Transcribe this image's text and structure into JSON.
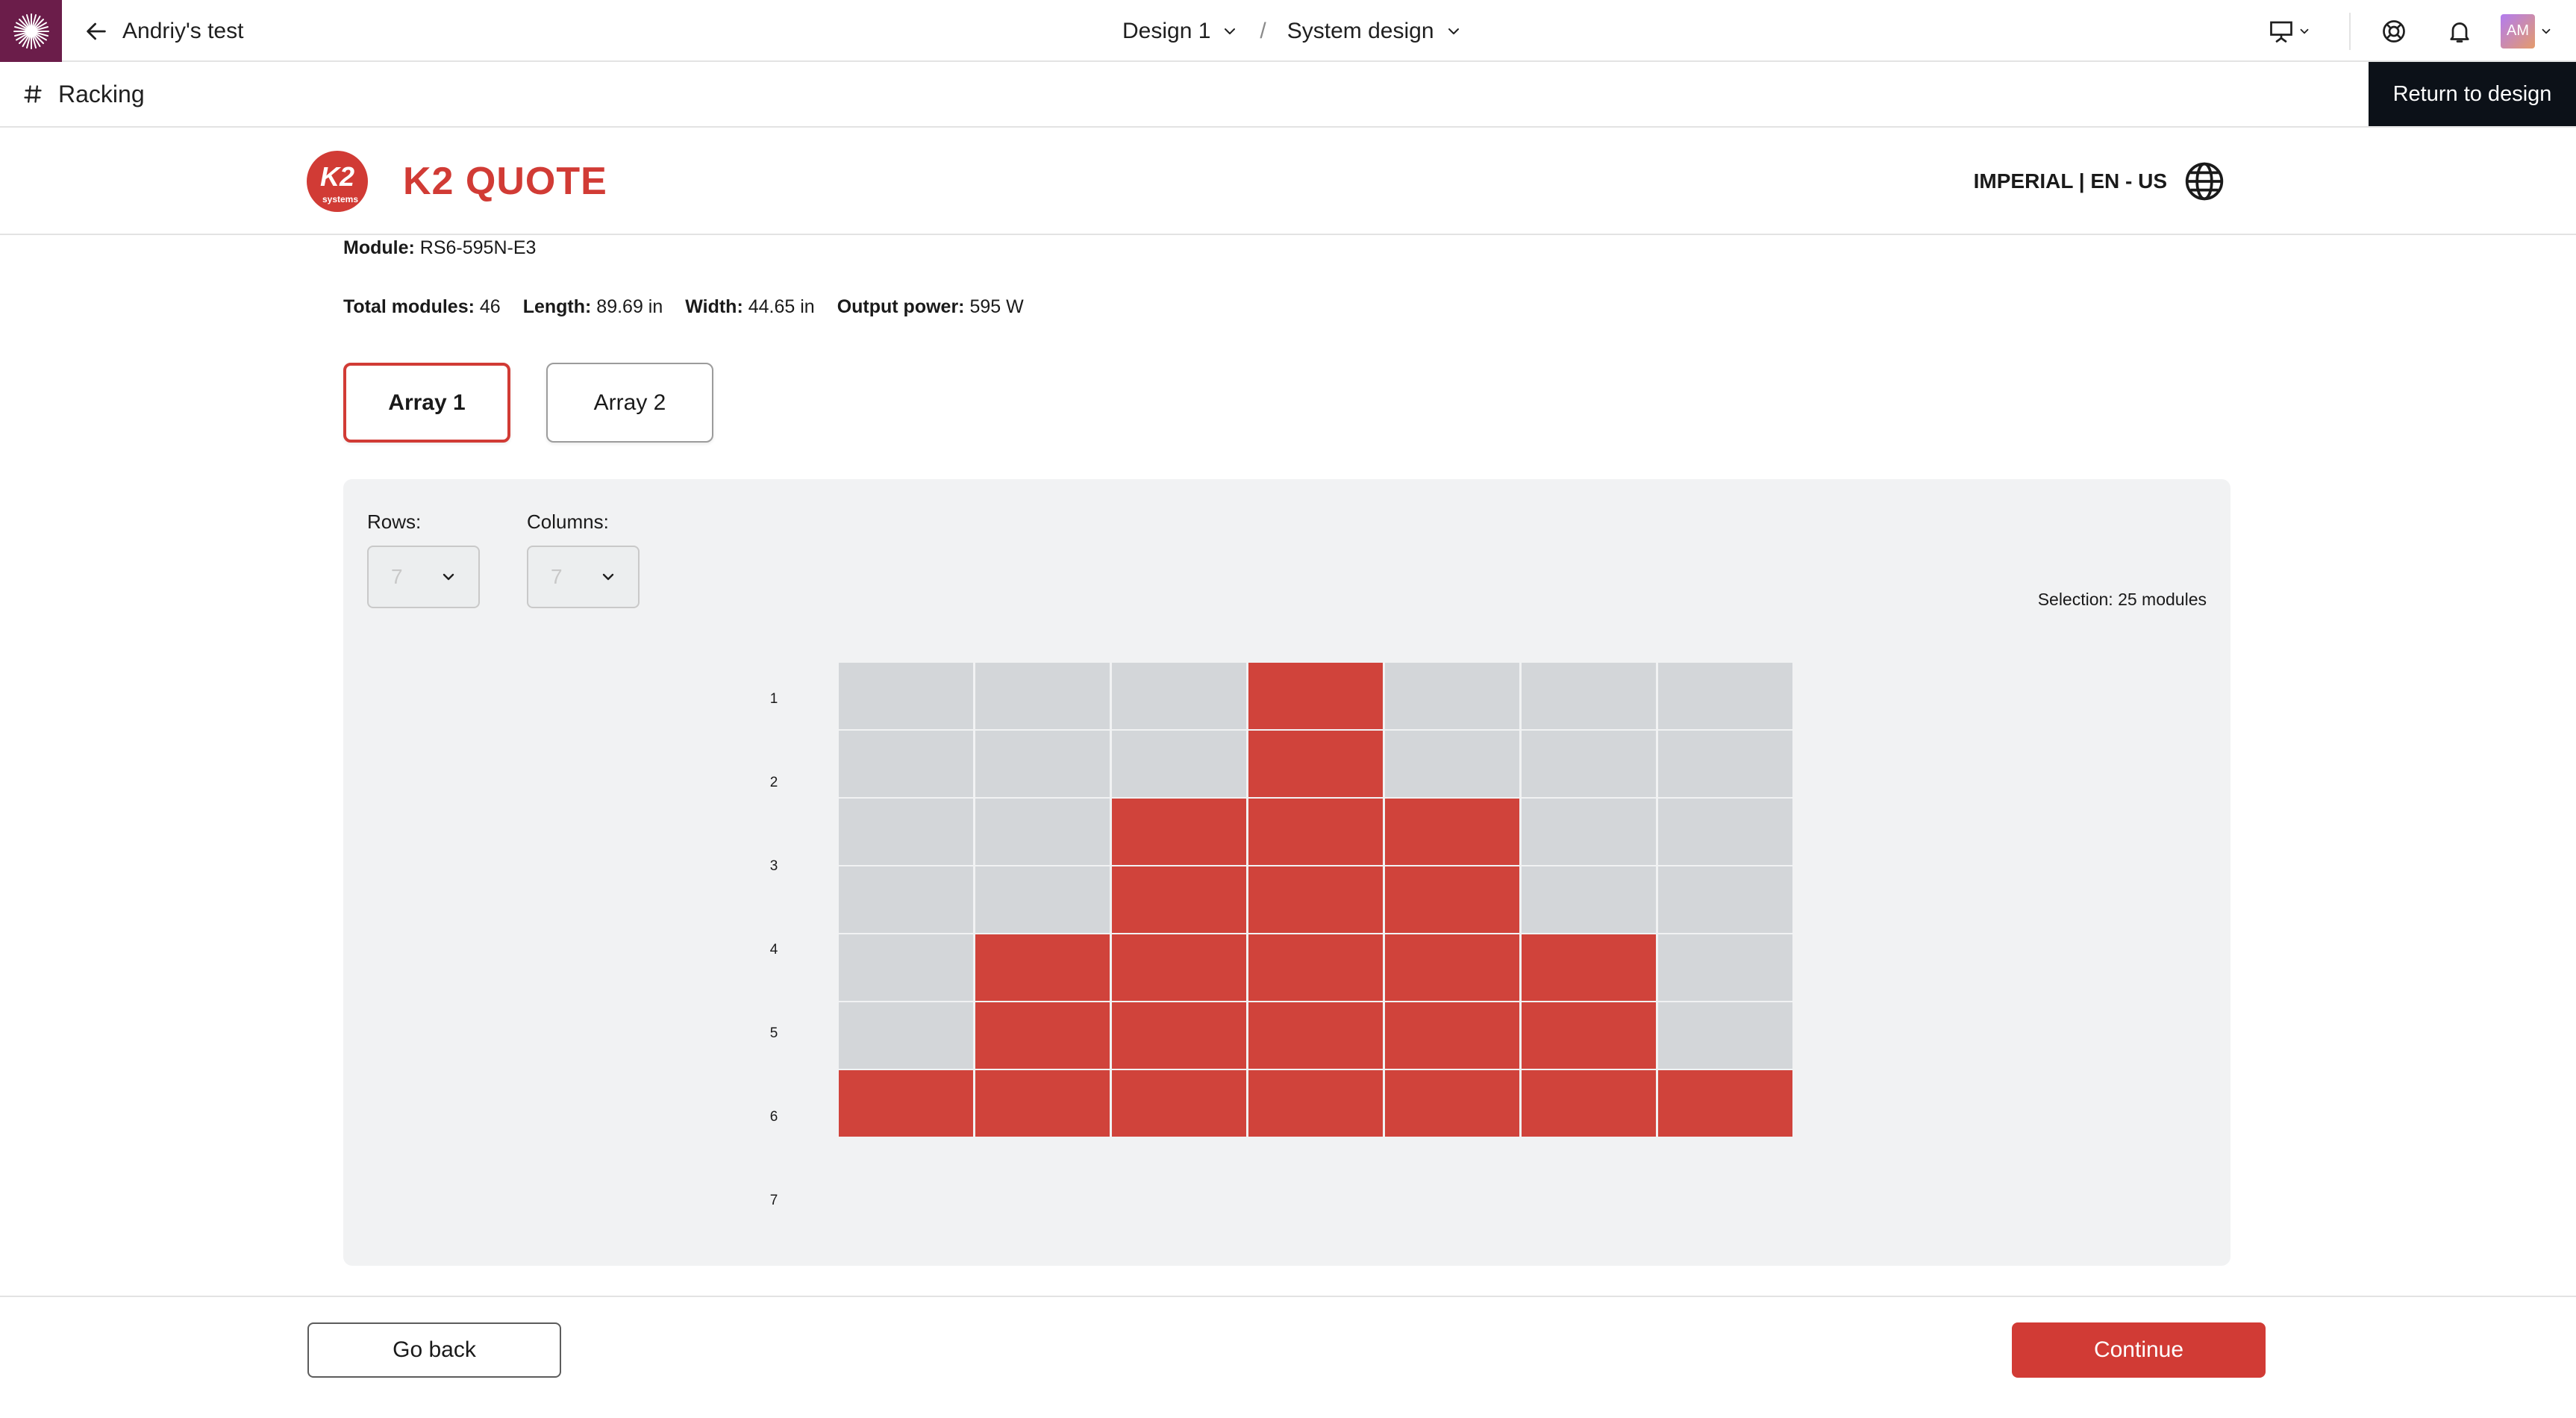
{
  "app": {
    "brand_color": "#6b1d4a"
  },
  "topbar": {
    "back_label": "Andriy's test",
    "breadcrumbs": [
      {
        "label": "Design 1"
      },
      {
        "label": "System design"
      }
    ],
    "separator": "/",
    "avatar_initials": "AM",
    "icons": [
      "presentation-icon",
      "help-icon",
      "bell-icon",
      "avatar"
    ]
  },
  "racking": {
    "title": "Racking",
    "return_label": "Return to design"
  },
  "k2": {
    "logo_text": "K2",
    "logo_subtext": "systems",
    "title": "K2 QUOTE",
    "locale": "IMPERIAL | EN - US",
    "accent_color": "#d13b35"
  },
  "module": {
    "label": "Module:",
    "value": "RS6-595N-E3",
    "specs": [
      {
        "label": "Total modules:",
        "value": "46"
      },
      {
        "label": "Length:",
        "value": "89.69 in"
      },
      {
        "label": "Width:",
        "value": "44.65 in"
      },
      {
        "label": "Output power:",
        "value": "595 W"
      }
    ]
  },
  "arrays": {
    "tabs": [
      "Array 1",
      "Array 2"
    ],
    "active_index": 0
  },
  "grid": {
    "rows_label": "Rows:",
    "rows_value": "7",
    "columns_label": "Columns:",
    "columns_value": "7",
    "selection_text": "Selection: 25 modules",
    "row_labels": [
      "1",
      "2",
      "3",
      "4",
      "5",
      "6",
      "7"
    ],
    "cells": [
      [
        0,
        0,
        0,
        1,
        0,
        0,
        0
      ],
      [
        0,
        0,
        0,
        1,
        0,
        0,
        0
      ],
      [
        0,
        0,
        1,
        1,
        1,
        0,
        0
      ],
      [
        0,
        0,
        1,
        1,
        1,
        0,
        0
      ],
      [
        0,
        1,
        1,
        1,
        1,
        1,
        0
      ],
      [
        0,
        1,
        1,
        1,
        1,
        1,
        0
      ],
      [
        1,
        1,
        1,
        1,
        1,
        1,
        1
      ]
    ]
  },
  "footer": {
    "back_label": "Go back",
    "continue_label": "Continue"
  }
}
